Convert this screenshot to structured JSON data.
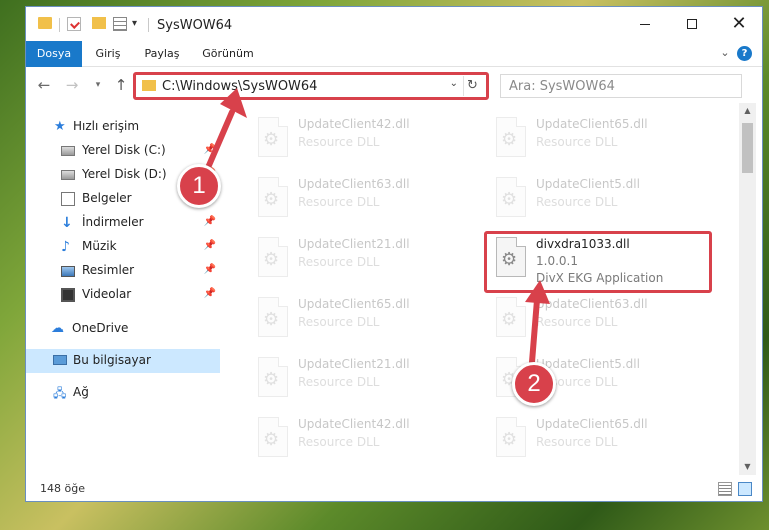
{
  "window": {
    "title": "SysWOW64"
  },
  "ribbon": {
    "tabs": [
      "Dosya",
      "Giriş",
      "Paylaş",
      "Görünüm"
    ],
    "help": "?"
  },
  "address": {
    "path": "C:\\Windows\\SysWOW64",
    "search_placeholder": "Ara: SysWOW64"
  },
  "sidebar": {
    "items": [
      {
        "label": "Hızlı erişim",
        "icon": "star-icon"
      },
      {
        "label": "Yerel Disk (C:)",
        "icon": "drive-icon",
        "pinned": true
      },
      {
        "label": "Yerel Disk (D:)",
        "icon": "drive-icon",
        "pinned": true
      },
      {
        "label": "Belgeler",
        "icon": "documents-icon",
        "pinned": true
      },
      {
        "label": "İndirmeler",
        "icon": "downloads-icon",
        "pinned": true
      },
      {
        "label": "Müzik",
        "icon": "music-icon",
        "pinned": true
      },
      {
        "label": "Resimler",
        "icon": "pictures-icon",
        "pinned": true
      },
      {
        "label": "Videolar",
        "icon": "videos-icon",
        "pinned": true
      },
      {
        "label": "OneDrive",
        "icon": "cloud-icon"
      },
      {
        "label": "Bu bilgisayar",
        "icon": "computer-icon",
        "selected": true
      },
      {
        "label": "Ağ",
        "icon": "network-icon"
      }
    ]
  },
  "files": {
    "left": [
      {
        "name": "UpdateClient42.dll",
        "type": "Resource DLL"
      },
      {
        "name": "UpdateClient63.dll",
        "type": "Resource DLL"
      },
      {
        "name": "UpdateClient21.dll",
        "type": "Resource DLL"
      },
      {
        "name": "UpdateClient65.dll",
        "type": "Resource DLL"
      },
      {
        "name": "UpdateClient21.dll",
        "type": "Resource DLL"
      },
      {
        "name": "UpdateClient42.dll",
        "type": "Resource DLL"
      }
    ],
    "right": [
      {
        "name": "UpdateClient65.dll",
        "type": "Resource DLL"
      },
      {
        "name": "UpdateClient5.dll",
        "type": "Resource DLL"
      },
      {
        "name": "divxdra1033.dll",
        "version": "1.0.0.1",
        "type": "DivX EKG Application",
        "highlighted": true
      },
      {
        "name": "UpdateClient63.dll",
        "type": "Resource DLL"
      },
      {
        "name": "UpdateClient5.dll",
        "type": "Resource DLL"
      },
      {
        "name": "UpdateClient65.dll",
        "type": "Resource DLL"
      }
    ]
  },
  "status": {
    "count": "148 öğe"
  },
  "callouts": [
    "1",
    "2"
  ],
  "colors": {
    "accent": "#1979ca",
    "highlight": "#d8414b",
    "selected": "#cce8ff"
  }
}
